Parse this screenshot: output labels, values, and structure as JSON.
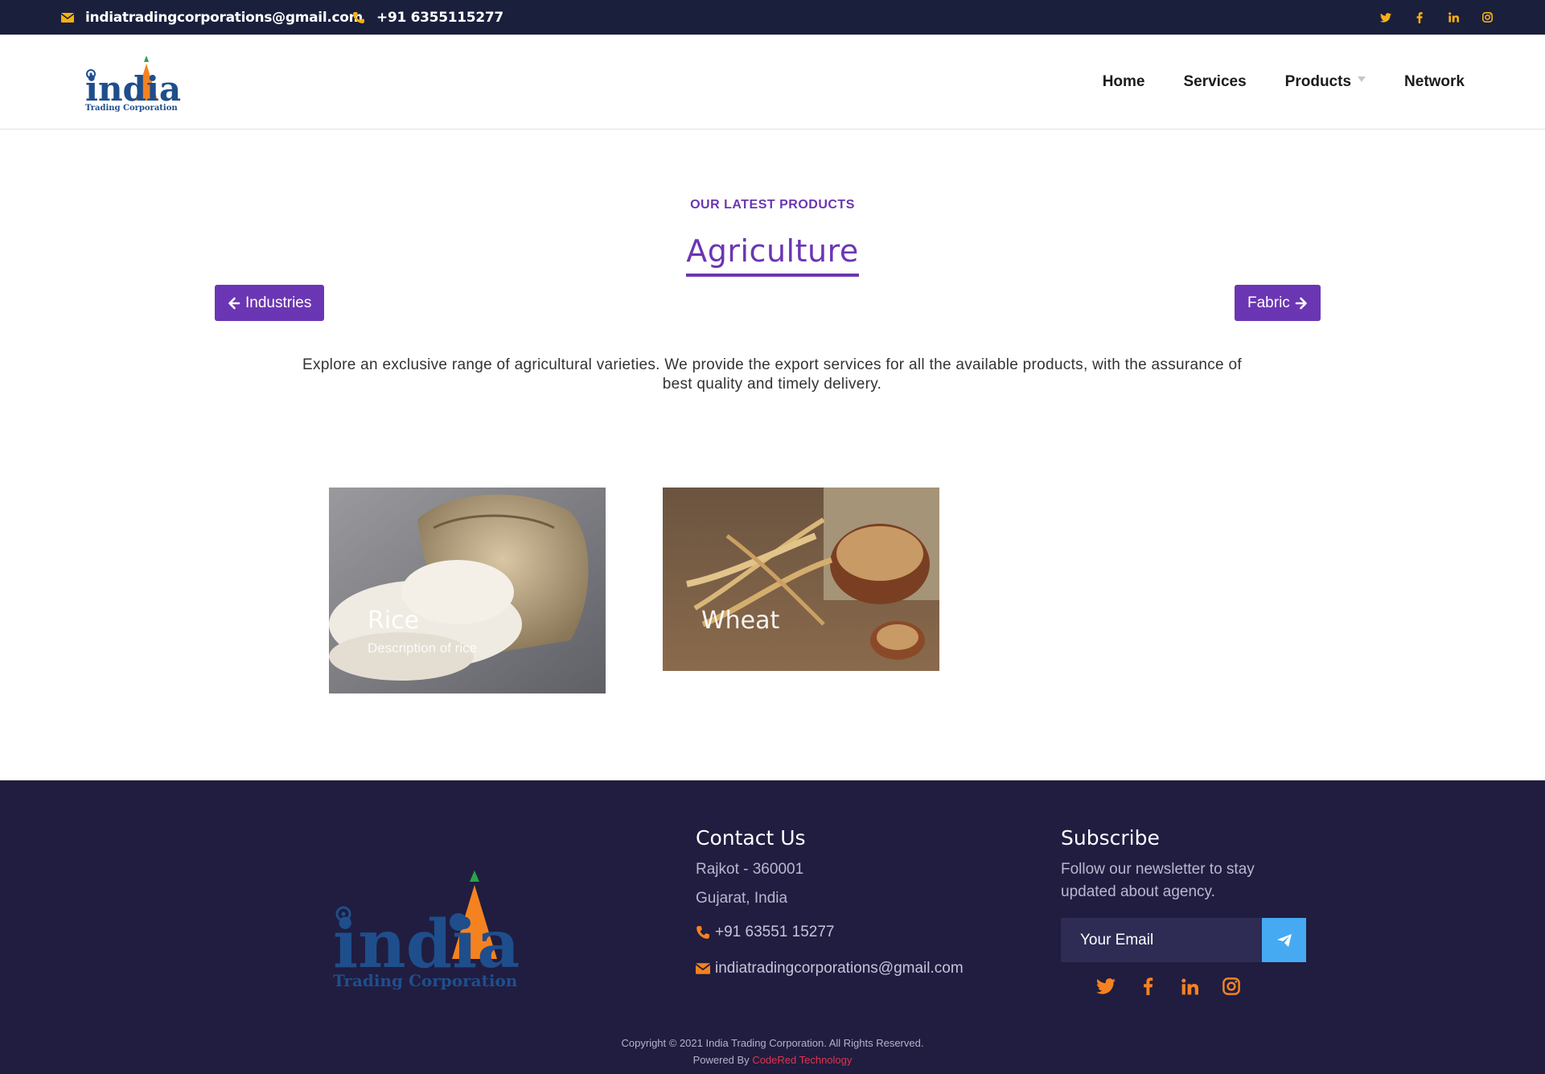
{
  "topbar": {
    "email": "indiatradingcorporations@gmail.com",
    "phone": "+91 6355115277",
    "email_icon": "envelope-icon",
    "phone_icon": "phone-icon",
    "social": [
      "twitter-icon",
      "facebook-icon",
      "linkedin-icon",
      "instagram-icon"
    ],
    "accent_color": "#f5b015"
  },
  "header": {
    "logo_word": "india",
    "logo_sub": "Trading Corporation",
    "nav": {
      "home": "Home",
      "services": "Services",
      "products": "Products",
      "network": "Network"
    }
  },
  "main": {
    "eyebrow": "OUR LATEST PRODUCTS",
    "title": "Agriculture",
    "prev_label": "Industries",
    "next_label": "Fabric",
    "description": "Explore an exclusive range of agricultural varieties. We provide the export services for all the available products, with the assurance of best quality and timely delivery.",
    "products": [
      {
        "title": "Rice",
        "description": "Description of rice"
      },
      {
        "title": "Wheat",
        "description": ""
      }
    ],
    "accent_color": "#6b36b3"
  },
  "footer": {
    "contact_heading": "Contact Us",
    "address_line1": "Rajkot - 360001",
    "address_line2": "Gujarat, India",
    "phone": "+91 63551 15277",
    "email": "indiatradingcorporations@gmail.com",
    "subscribe_heading": "Subscribe",
    "subscribe_text": "Follow our newsletter to stay updated about agency.",
    "email_placeholder": "Your Email",
    "social": [
      "twitter-icon",
      "facebook-icon",
      "linkedin-icon",
      "instagram-icon"
    ],
    "copyright": "Copyright © 2021 India Trading Corporation. All Rights Reserved.",
    "powered_by": "Powered By",
    "powered_brand": "CodeRed Technology",
    "icon_color": "#f58220"
  }
}
